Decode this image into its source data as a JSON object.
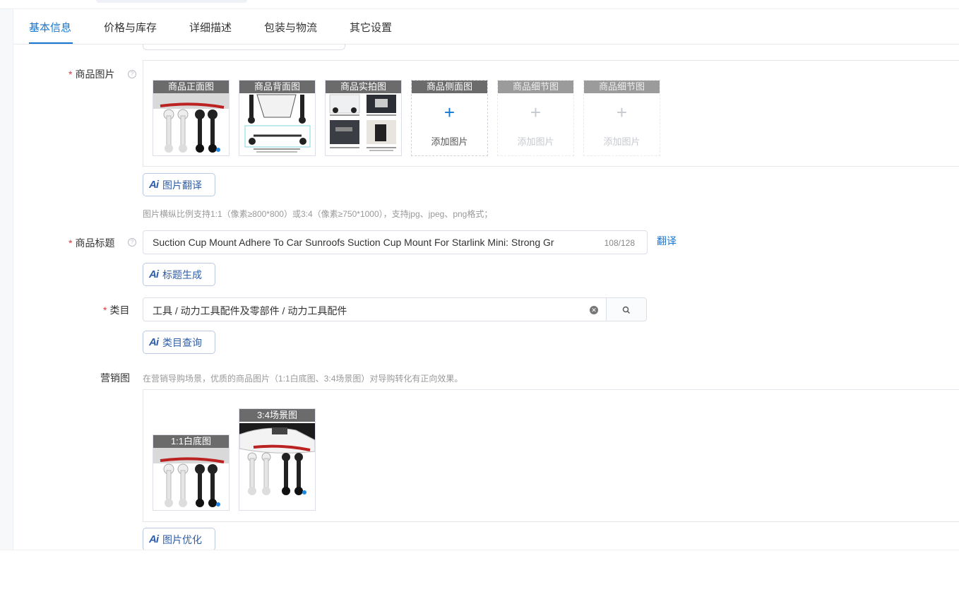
{
  "tabs": [
    {
      "label": "基本信息",
      "active": true
    },
    {
      "label": "价格与库存"
    },
    {
      "label": "详细描述"
    },
    {
      "label": "包装与物流"
    },
    {
      "label": "其它设置"
    }
  ],
  "product_images": {
    "label": "商品图片",
    "required_mark": "*",
    "help_icon": "question-circle-icon",
    "slots": [
      {
        "caption": "商品正面图",
        "state": "filled"
      },
      {
        "caption": "商品背面图",
        "state": "filled"
      },
      {
        "caption": "商品实拍图",
        "state": "filled"
      },
      {
        "caption": "商品侧面图",
        "state": "add",
        "add_label": "添加图片"
      },
      {
        "caption": "商品细节图",
        "state": "disabled",
        "add_label": "添加图片"
      },
      {
        "caption": "商品细节图",
        "state": "disabled",
        "add_label": "添加图片"
      }
    ],
    "ai_button": "图片翻译",
    "hint": "图片横纵比例支持1:1（像素≥800*800）或3:4（像素≥750*1000），支持jpg、jpeg、png格式；"
  },
  "title_field": {
    "label": "商品标题",
    "required_mark": "*",
    "value": "Suction Cup Mount Adhere To Car Sunroofs Suction Cup Mount For Starlink Mini: Strong Gr",
    "count": "108/128",
    "translate_link": "翻译",
    "ai_button": "标题生成"
  },
  "category_field": {
    "label": "类目",
    "required_mark": "*",
    "value": "工具 / 动力工具配件及零部件 / 动力工具配件",
    "ai_button": "类目查询"
  },
  "marketing": {
    "label": "营销图",
    "hint": "在营销导购场景，优质的商品图片（1:1白底图、3:4场景图）对导购转化有正向效果。",
    "images": [
      {
        "caption": "1:1白底图"
      },
      {
        "caption": "3:4场景图"
      }
    ],
    "ai_button": "图片优化"
  },
  "ai_badge": "Ai",
  "colors": {
    "accent": "#1677d2",
    "ai_text": "#2f5ea8",
    "required": "#e4393c"
  }
}
